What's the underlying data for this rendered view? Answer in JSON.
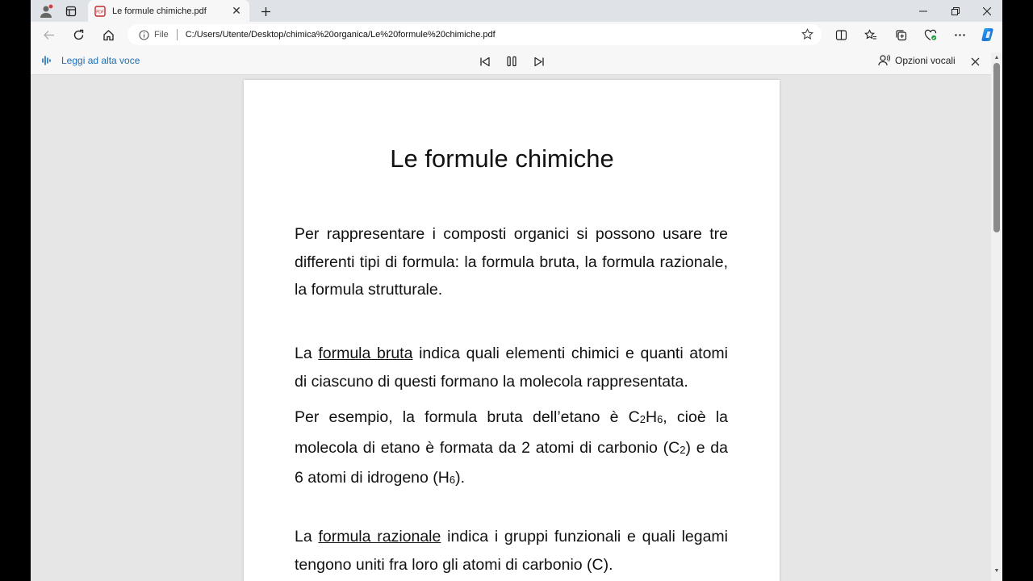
{
  "tab": {
    "title": "Le formule chimiche.pdf"
  },
  "address": {
    "scheme_label": "File",
    "url": "C:/Users/Utente/Desktop/chimica%20organica/Le%20formule%20chimiche.pdf"
  },
  "readaloud": {
    "label": "Leggi ad alta voce",
    "voice_options": "Opzioni vocali"
  },
  "document": {
    "title": "Le formule chimiche",
    "p1": "Per rappresentare i composti organici si possono usare tre differenti tipi di formula: la formula bruta, la formula razionale, la formula strutturale.",
    "p2_a": "La ",
    "p2_link": "formula bruta",
    "p2_b": " indica quali elementi chimici e quanti atomi di ciascuno di questi formano la molecola rappresentata.",
    "p3_a": "Per esempio, la formula bruta dell’etano è C",
    "p3_s1": "2",
    "p3_b": "H",
    "p3_s2": "6",
    "p3_c": ", cioè la molecola di etano è formata da 2 atomi di carbonio (C",
    "p3_s3": "2",
    "p3_d": ") e da 6 atomi di idrogeno (H",
    "p3_s4": "6",
    "p3_e": ").",
    "p4_a": "La ",
    "p4_link": "formula razionale",
    "p4_b": " indica i gruppi funzionali e quali legami tengono uniti fra loro gli atomi di carbonio (C)."
  },
  "colors": {
    "accent": "#1f6fb5",
    "pdf_icon": "#c8282a",
    "copilot": "#1a8fe3"
  }
}
